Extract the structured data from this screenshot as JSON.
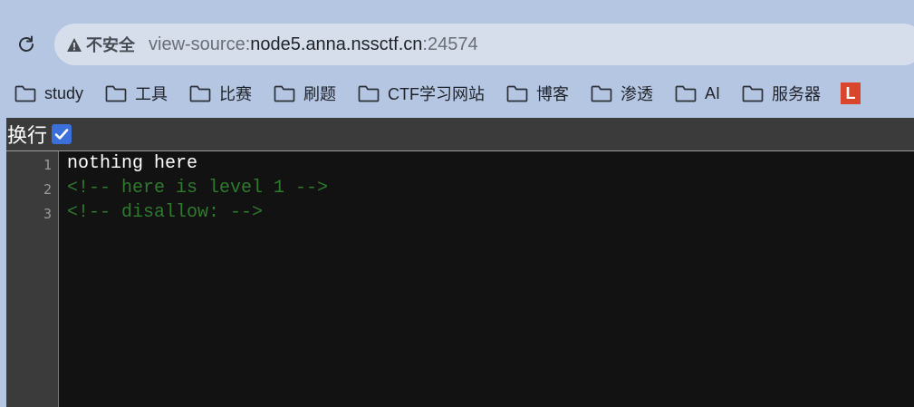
{
  "browser": {
    "security_label": "不安全",
    "url_prefix": "view-source:",
    "url_host": "node5.anna.nssctf.cn",
    "url_port": ":24574",
    "icons": {
      "reload": "reload-icon",
      "warning": "warning-icon",
      "folder": "folder-icon"
    }
  },
  "bookmarks": [
    {
      "label": "study"
    },
    {
      "label": "工具"
    },
    {
      "label": "比赛"
    },
    {
      "label": "刷题"
    },
    {
      "label": "CTF学习网站"
    },
    {
      "label": "博客"
    },
    {
      "label": "渗透"
    },
    {
      "label": "AI"
    },
    {
      "label": "服务器"
    }
  ],
  "bookmark_overflow_glyph": "L",
  "viewer": {
    "wrap_label": "换行",
    "wrap_checked": true,
    "lines": [
      {
        "number": "1",
        "text": "nothing here",
        "kind": "plain"
      },
      {
        "number": "2",
        "text": "<!-- here is level 1 -->",
        "kind": "comment"
      },
      {
        "number": "3",
        "text": "<!-- disallow: -->",
        "kind": "comment"
      }
    ]
  },
  "colors": {
    "toolbar_bg": "#b5c6e3",
    "omnibox_bg": "#d6deec",
    "code_bg": "#121212",
    "gutter_bg": "#3b3b3b",
    "comment": "#2f7a2f",
    "checkbox": "#3b6fd9",
    "overflow_badge": "#d9462b"
  }
}
